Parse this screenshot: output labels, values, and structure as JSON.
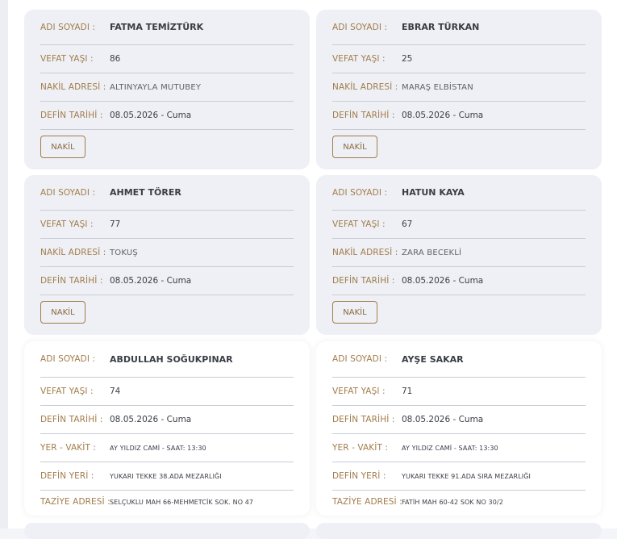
{
  "labels": {
    "name": "ADI SOYADI :",
    "age": "VEFAT YAŞI :",
    "transfer_address": "NAKİL ADRESİ :",
    "burial_date": "DEFİN TARİHİ :",
    "place_time": "YER - VAKİT :",
    "burial_place": "DEFİN YERİ :",
    "condolence_address": "TAZİYE ADRESİ :"
  },
  "nakil_button_label": "NAKİL",
  "transfer_cards": [
    {
      "name": "FATMA TEMİZTÜRK",
      "age": "86",
      "transfer_address": "ALTINYAYLA MUTUBEY",
      "burial_date": "08.05.2026 - Cuma"
    },
    {
      "name": "EBRAR TÜRKAN",
      "age": "25",
      "transfer_address": "MARAŞ ELBİSTAN",
      "burial_date": "08.05.2026 - Cuma"
    },
    {
      "name": "AHMET TÖRER",
      "age": "77",
      "transfer_address": "TOKUŞ",
      "burial_date": "08.05.2026 - Cuma"
    },
    {
      "name": "HATUN KAYA",
      "age": "67",
      "transfer_address": "ZARA BECEKLİ",
      "burial_date": "08.05.2026 - Cuma"
    }
  ],
  "funeral_cards": [
    {
      "name": "ABDULLAH SOĞUKPINAR",
      "age": "74",
      "burial_date": "08.05.2026 - Cuma",
      "place_time": "AY YILDIZ CAMİ - SAAT: 13:30",
      "burial_place": "YUKARI TEKKE 38.ADA MEZARLIĞI",
      "condolence_address": "SELÇUKLU MAH 66-MEHMETCİK SOK. NO 47"
    },
    {
      "name": "AYŞE SAKAR",
      "age": "71",
      "burial_date": "08.05.2026 - Cuma",
      "place_time": "AY YILDIZ CAMİ - SAAT: 13:30",
      "burial_place": "YUKARI TEKKE 91.ADA SIRA MEZARLIĞI",
      "condolence_address": "FATİH MAH 60-42 SOK NO 30/2"
    }
  ]
}
